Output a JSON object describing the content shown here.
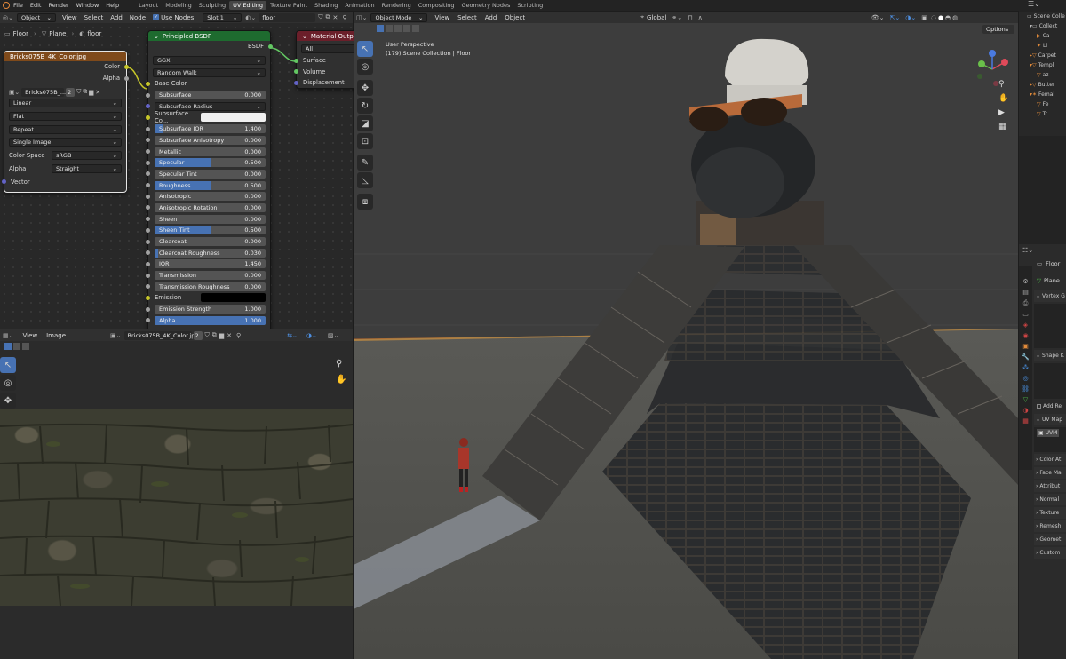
{
  "topbar": {
    "menus": [
      "File",
      "Edit",
      "Render",
      "Window",
      "Help"
    ],
    "workspaces": [
      "Layout",
      "Modeling",
      "Sculpting",
      "UV Editing",
      "Texture Paint",
      "Shading",
      "Animation",
      "Rendering",
      "Compositing",
      "Geometry Nodes",
      "Scripting"
    ],
    "active_workspace": "UV Editing"
  },
  "node_header": {
    "mode": "Object",
    "menus": [
      "View",
      "Select",
      "Add",
      "Node"
    ],
    "use_nodes": "Use Nodes",
    "slot": "Slot 1",
    "material": "floor"
  },
  "breadcrumb": {
    "object": "Floor",
    "mesh": "Plane",
    "material": "floor"
  },
  "image_node": {
    "title": "Bricks075B_4K_Color.jpg",
    "out_color": "Color",
    "out_alpha": "Alpha",
    "image_name": "Bricks075B_...",
    "users": "2",
    "interpolation": "Linear",
    "projection": "Flat",
    "extension": "Repeat",
    "source": "Single Image",
    "color_space_label": "Color Space",
    "color_space": "sRGB",
    "alpha_label": "Alpha",
    "alpha_mode": "Straight",
    "vector": "Vector"
  },
  "bsdf": {
    "title": "Principled BSDF",
    "out": "BSDF",
    "distribution": "GGX",
    "subsurface_method": "Random Walk",
    "base_color": "Base Color",
    "rows": [
      {
        "label": "Subsurface",
        "value": "0.000",
        "fill": 0
      },
      {
        "label": "Subsurface Radius",
        "value": "",
        "fill": 0,
        "dropdown": true
      },
      {
        "label": "Subsurface Co...",
        "value": "",
        "fill": 0,
        "color": true
      },
      {
        "label": "Subsurface IOR",
        "value": "1.400",
        "fill": 0.08
      },
      {
        "label": "Subsurface Anisotropy",
        "value": "0.000",
        "fill": 0
      },
      {
        "label": "Metallic",
        "value": "0.000",
        "fill": 0
      },
      {
        "label": "Specular",
        "value": "0.500",
        "fill": 0.5
      },
      {
        "label": "Specular Tint",
        "value": "0.000",
        "fill": 0
      },
      {
        "label": "Roughness",
        "value": "0.500",
        "fill": 0.5
      },
      {
        "label": "Anisotropic",
        "value": "0.000",
        "fill": 0
      },
      {
        "label": "Anisotropic Rotation",
        "value": "0.000",
        "fill": 0
      },
      {
        "label": "Sheen",
        "value": "0.000",
        "fill": 0
      },
      {
        "label": "Sheen Tint",
        "value": "0.500",
        "fill": 0.5
      },
      {
        "label": "Clearcoat",
        "value": "0.000",
        "fill": 0
      },
      {
        "label": "Clearcoat Roughness",
        "value": "0.030",
        "fill": 0.03
      },
      {
        "label": "IOR",
        "value": "1.450",
        "fill": 0
      },
      {
        "label": "Transmission",
        "value": "0.000",
        "fill": 0
      },
      {
        "label": "Transmission Roughness",
        "value": "0.000",
        "fill": 0
      }
    ],
    "emission": "Emission",
    "emission_strength": "Emission Strength",
    "emission_strength_value": "1.000",
    "alpha_label": "Alpha",
    "alpha_value": "1.000"
  },
  "material_output": {
    "title": "Material Output",
    "target": "All",
    "surface": "Surface",
    "volume": "Volume",
    "displacement": "Displacement"
  },
  "image_editor": {
    "menus": [
      "View",
      "Image"
    ],
    "image": "Bricks075B_4K_Color.jpg",
    "users": "2"
  },
  "viewport": {
    "mode": "Object Mode",
    "menus": [
      "View",
      "Select",
      "Add",
      "Object"
    ],
    "orientation": "Global",
    "options": "Options",
    "perspective": "User Perspective",
    "collection": "(179) Scene Collection | Floor"
  },
  "outliner": {
    "items": [
      "Scene Colle",
      "Collect",
      "Ca",
      "Li",
      "Carpet",
      "Templ",
      "az",
      "Butter",
      "Femal",
      "Fe",
      "Tr"
    ]
  },
  "properties": {
    "object": "Floor",
    "mesh": "Plane",
    "panels": [
      "Vertex G",
      "Shape K",
      "UV Map",
      "Color At",
      "Face Ma",
      "Attribut",
      "Normal",
      "Texture",
      "Remesh",
      "Geomet",
      "Custom"
    ],
    "add_rest": "Add Re",
    "uv_item": "UVM"
  },
  "colors": {
    "accent": "#4772b3",
    "header_shader": "#1e6b2f",
    "header_texture": "#7f4a1b",
    "header_output": "#6b1f2a"
  }
}
